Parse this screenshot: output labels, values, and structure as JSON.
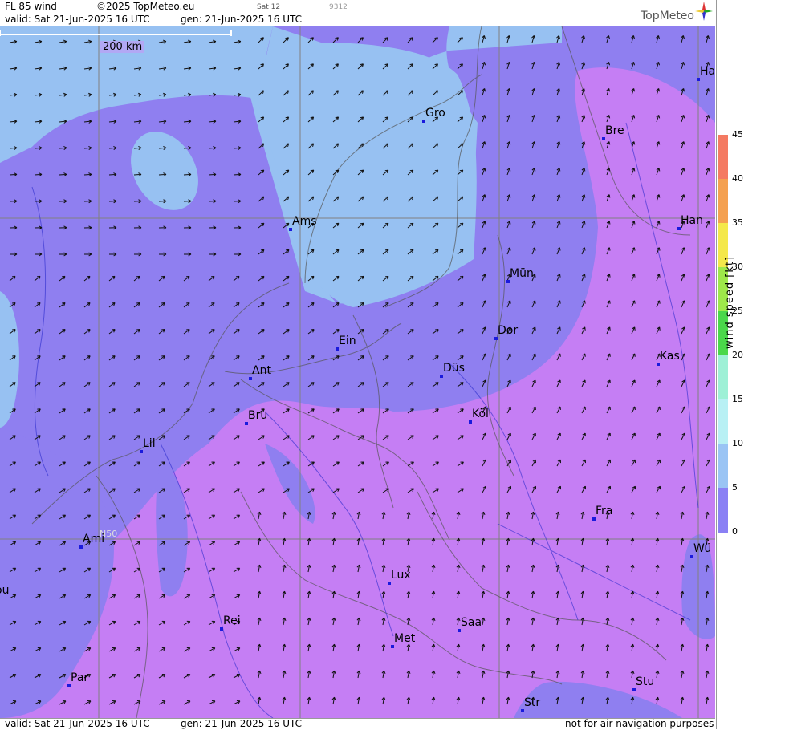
{
  "header": {
    "product": "FL 85 wind",
    "copyright": "©2025 TopMeteo.eu",
    "day": "Sat 12",
    "code": "9312",
    "valid": "valid:  Sat  21-Jun-2025  16 UTC",
    "generated": "gen:  21-Jun-2025 16 UTC",
    "logo": "TopMeteo"
  },
  "footer": {
    "valid": "valid:  Sat  21-Jun-2025  16 UTC",
    "generated": "gen:  21-Jun-2025 16 UTC",
    "disclaimer": "not for air navigation purposes"
  },
  "scale_label": "200 km",
  "grid_label": "N50",
  "legend": {
    "title": "wind  speed  [kt]",
    "ticks": [
      "45",
      "40",
      "35",
      "30",
      "25",
      "20",
      "15",
      "10",
      "5",
      "0"
    ],
    "colors": [
      "#f47a62",
      "#f4a050",
      "#f4e84a",
      "#9ee84a",
      "#4ad84a",
      "#9ef0d6",
      "#b8f0f4",
      "#9ac4f4",
      "#8a80f4",
      "#c57ef4"
    ]
  },
  "colors": {
    "speed_0_5": "#c57ef4",
    "speed_5_10": "#8f7ff0",
    "speed_10_15": "#97c1f2",
    "city_dot": "#1a1adc"
  },
  "cities": [
    "Gro",
    "Bre",
    "Ha",
    "Han",
    "Ams",
    "Mün",
    "Ein",
    "Dor",
    "Ant",
    "Düs",
    "Kas",
    "Köl",
    "Bru",
    "Lil",
    "Fra",
    "Ami",
    "Wü",
    "Lux",
    "ou",
    "Rei",
    "Saa",
    "Met",
    "Par",
    "Stu",
    "Str"
  ]
}
